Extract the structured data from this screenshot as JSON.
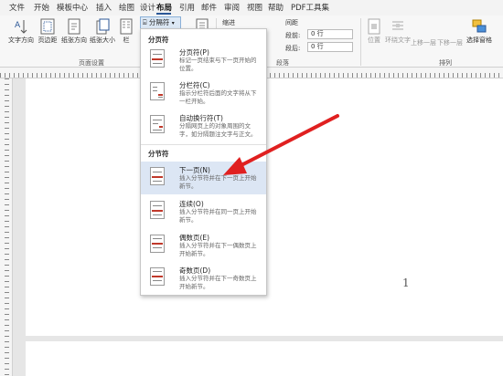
{
  "menu": {
    "items": [
      "文件",
      "开始",
      "模板中心",
      "插入",
      "绘图",
      "设计",
      "布局",
      "引用",
      "邮件",
      "审阅",
      "视图",
      "帮助",
      "PDF工具集"
    ],
    "active_index": 6
  },
  "ribbon": {
    "text_direction": "文字方向",
    "margins": "页边距",
    "orientation": "纸张方向",
    "size": "纸张大小",
    "columns": "栏",
    "breaks_button": "分隔符",
    "page_setup_group": "页面设置",
    "indent_label": "缩进",
    "spacing_label": "间距",
    "spacing_before_label": "段前:",
    "spacing_after_label": "段后:",
    "spacing_before_value": "0 行",
    "spacing_after_value": "0 行",
    "paragraph_group": "段落",
    "position": "位置",
    "wrap_text": "环绕文字",
    "bring_forward": "上移一层",
    "send_backward": "下移一层",
    "selection_pane": "选择窗格",
    "arrange_group": "排列"
  },
  "dropdown": {
    "page_breaks_header": "分页符",
    "section_breaks_header": "分节符",
    "items": [
      {
        "title": "分页符(P)",
        "desc": "标记一页结束与下一页开始的\n位置。"
      },
      {
        "title": "分栏符(C)",
        "desc": "指示分栏符后面的文字将从下\n一栏开始。"
      },
      {
        "title": "自动换行符(T)",
        "desc": "分隔网页上的对象周围的文\n字，如分隔题注文字与正文。"
      },
      {
        "title": "下一页(N)",
        "desc": "插入分节符并在下一页上开始\n新节。"
      },
      {
        "title": "连续(O)",
        "desc": "插入分节符并在同一页上开始\n新节。"
      },
      {
        "title": "偶数页(E)",
        "desc": "插入分节符并在下一偶数页上\n开始新节。"
      },
      {
        "title": "奇数页(D)",
        "desc": "插入分节符并在下一奇数页上\n开始新节。"
      }
    ]
  },
  "document": {
    "page_number": "1"
  },
  "colors": {
    "accent": "#2b5797",
    "highlight": "#dce6f4",
    "arrow": "#e02020"
  }
}
